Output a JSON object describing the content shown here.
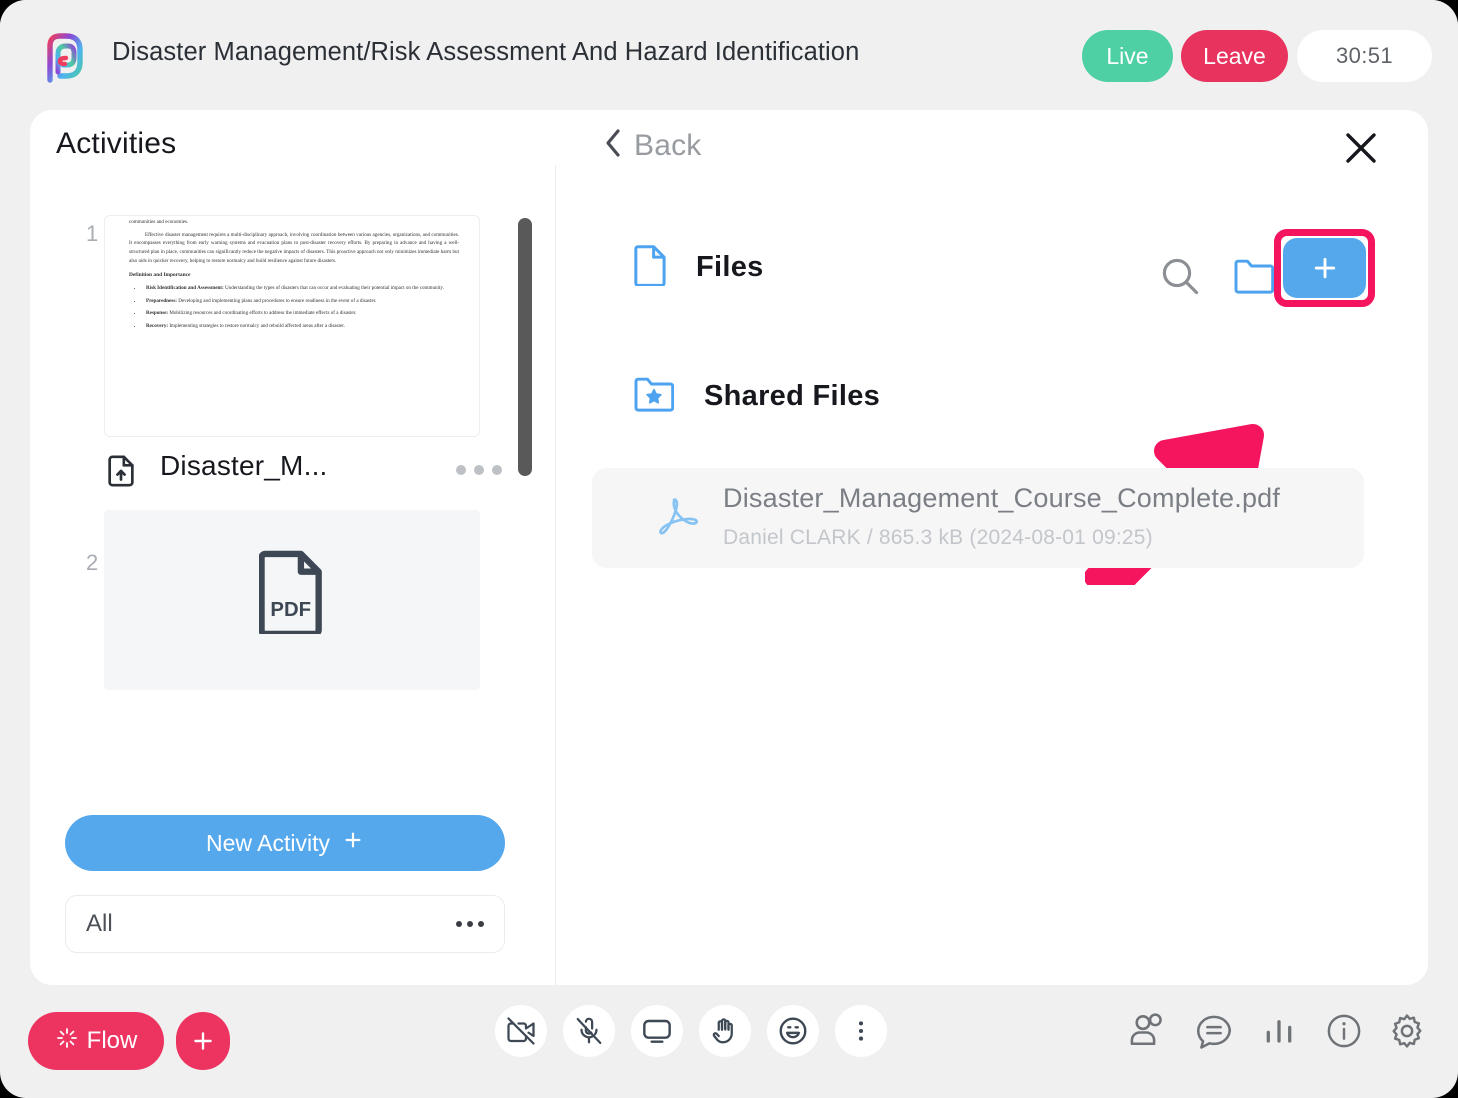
{
  "header": {
    "logo_icon": "pleex-spiral-logo",
    "title": "Disaster Management/Risk Assessment And Hazard Identification",
    "live_label": "Live",
    "leave_label": "Leave",
    "timer": "30:51"
  },
  "sidebar": {
    "title": "Activities",
    "activities": [
      {
        "number": "1",
        "label": "Disaster_M...",
        "type": "document",
        "thumbnail_text": {
          "para1": "arise. The importance of disaster management cannot be overstated, as it plays a crucial role in saving lives, protecting property, and ensuring the sustainability of communities and economies.",
          "para2": "Effective disaster management requires a multi-disciplinary approach, involving coordination between various agencies, organizations, and communities. It encompasses everything from early warning systems and evacuation plans to post-disaster recovery efforts. By preparing in advance and having a well-structured plan in place, communities can significantly reduce the negative impacts of disasters. This proactive approach not only minimizes immediate harm but also aids in quicker recovery, helping to restore normalcy and build resilience against future disasters.",
          "heading": "Definition and Importance",
          "bullets": [
            {
              "term": "Risk Identification and Assessment:",
              "text": " Understanding the types of disasters that can occur and evaluating their potential impact on the community."
            },
            {
              "term": "Preparedness:",
              "text": " Developing and implementing plans and procedures to ensure readiness in the event of a disaster."
            },
            {
              "term": "Response:",
              "text": " Mobilizing resources and coordinating efforts to address the immediate effects of a disaster."
            },
            {
              "term": "Recovery:",
              "text": " Implementing strategies to restore normalcy and rebuild affected areas after a disaster."
            }
          ]
        }
      },
      {
        "number": "2",
        "label": "PDF",
        "type": "pdf"
      }
    ],
    "new_activity_label": "New Activity",
    "filter_label": "All"
  },
  "panel": {
    "back_label": "Back",
    "close_icon": "close-icon",
    "files_label": "Files",
    "shared_files_label": "Shared Files",
    "actions": {
      "search_icon": "search-icon",
      "new_folder_icon": "folder-icon",
      "add_label": "+"
    },
    "file": {
      "name": "Disaster_Management_Course_Complete.pdf",
      "meta": "Daniel CLARK  /  865.3 kB (2024-08-01 09:25)",
      "icon": "pdf-acrobat-icon"
    }
  },
  "bottombar": {
    "flow_label": "Flow",
    "add_label": "+",
    "center_icons": [
      "camera-off-icon",
      "mic-off-icon",
      "screen-share-icon",
      "raise-hand-icon",
      "reactions-icon",
      "more-options-icon"
    ],
    "right_icons": [
      "participants-icon",
      "chat-icon",
      "polls-icon",
      "info-icon",
      "settings-icon"
    ]
  },
  "colors": {
    "accent_blue": "#55a8ec",
    "accent_pink": "#ed3461",
    "highlight_pink": "#f5145e",
    "live_green": "#4ecfa4",
    "leave_red": "#e8335f"
  }
}
